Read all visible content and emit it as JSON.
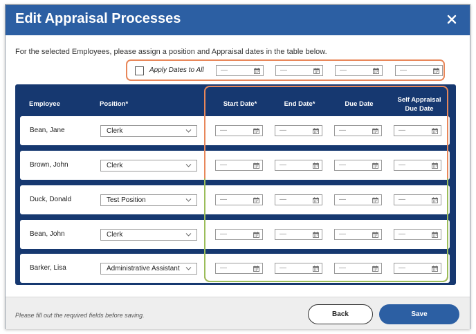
{
  "dialog": {
    "title": "Edit Appraisal Processes",
    "instructions": "For the selected Employees, please assign a position and Appraisal dates in the table below."
  },
  "apply_all": {
    "label": "Apply Dates to All",
    "checked": false,
    "dates": [
      "—",
      "—",
      "—",
      "—"
    ]
  },
  "table": {
    "columns": {
      "employee": "Employee",
      "position": "Position*",
      "start_date": "Start Date*",
      "end_date": "End Date*",
      "due_date": "Due Date",
      "self_due_line1": "Self Appraisal",
      "self_due_line2": "Due Date"
    },
    "rows": [
      {
        "employee": "Bean, Jane",
        "position": "Clerk",
        "dates": [
          "—",
          "—",
          "—",
          "—"
        ]
      },
      {
        "employee": "Brown, John",
        "position": "Clerk",
        "dates": [
          "—",
          "—",
          "—",
          "—"
        ]
      },
      {
        "employee": "Duck, Donald",
        "position": "Test Position",
        "dates": [
          "—",
          "—",
          "—",
          "—"
        ]
      },
      {
        "employee": "Bean, John",
        "position": "Clerk",
        "dates": [
          "—",
          "—",
          "—",
          "—"
        ]
      },
      {
        "employee": "Barker, Lisa",
        "position": "Administrative Assistant",
        "dates": [
          "—",
          "—",
          "—",
          "—"
        ]
      }
    ]
  },
  "footer": {
    "note": "Please fill out the required fields before saving.",
    "back_label": "Back",
    "save_label": "Save"
  },
  "colors": {
    "header": "#2c5fa3",
    "grid_bg": "#163870",
    "highlight_orange": "#e8875a",
    "highlight_green": "#9bbd5a"
  },
  "icons": [
    "close-icon",
    "calendar-icon",
    "chevron-down-icon"
  ]
}
